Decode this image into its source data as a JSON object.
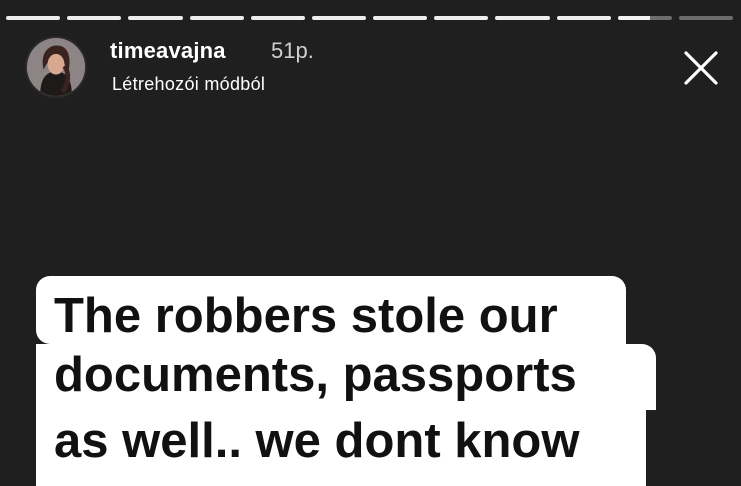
{
  "story": {
    "progress": {
      "segments_total": 12,
      "segments_complete": 10,
      "current_segment_fraction": 0.6
    },
    "header": {
      "username": "timeavajna",
      "time_ago": "51p.",
      "subtitle": "Létrehozói módból",
      "avatar_icon": "profile-photo",
      "close_icon": "close-icon"
    },
    "text_card": {
      "lines": [
        "The robbers stole our",
        "documents, passports",
        "as well.. we dont know"
      ]
    }
  }
}
